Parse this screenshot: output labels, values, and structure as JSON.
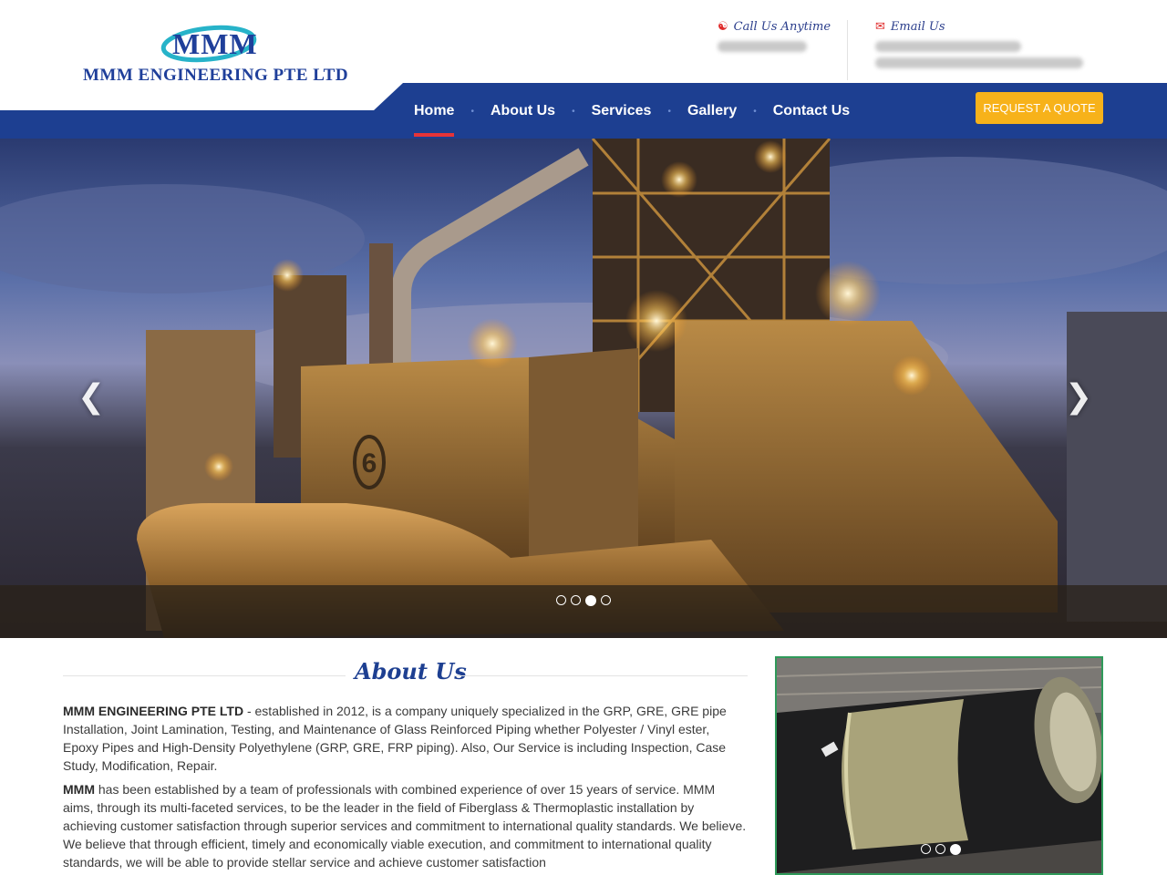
{
  "brand": {
    "logo_mark": "MMM",
    "company_name": "MMM ENGINEERING PTE LTD"
  },
  "contact": {
    "call_title": "Call Us Anytime",
    "call_icon": "headset-icon",
    "email_title": "Email Us",
    "email_icon": "envelope-icon"
  },
  "nav": {
    "items": [
      {
        "label": "Home",
        "active": true
      },
      {
        "label": "About Us",
        "active": false
      },
      {
        "label": "Services",
        "active": false
      },
      {
        "label": "Gallery",
        "active": false
      },
      {
        "label": "Contact Us",
        "active": false
      }
    ],
    "separator": "•",
    "quote_button": "REQUEST A QUOTE"
  },
  "hero": {
    "prev_icon": "chevron-left-icon",
    "next_icon": "chevron-right-icon",
    "slide_count": 4,
    "active_slide": 3,
    "scene_label": "6"
  },
  "about": {
    "title": "About Us",
    "p1_lead": "MMM ENGINEERING PTE LTD",
    "p1_text": " - established in 2012, is a company uniquely specialized in the GRP, GRE, GRE pipe Installation, Joint Lamination, Testing, and Maintenance of Glass Reinforced Piping whether Polyester / Vinyl ester, Epoxy Pipes and High-Density Polyethylene (GRP, GRE, FRP piping). Also, Our Service is including Inspection, Case Study, Modification, Repair.",
    "p2_lead": "MMM",
    "p2_text": " has been established by a team of professionals with combined experience of over 15 years of service. MMM aims, through its multi-faceted services, to be the leader in the field of Fiberglass & Thermoplastic installation by achieving customer satisfaction through superior services and commitment to international quality standards. We believe. We believe that through efficient, timely and economically viable execution, and commitment to international quality standards, we will be able to provide stellar service and achieve customer satisfaction"
  },
  "side_slider": {
    "slide_count": 3,
    "active_slide": 3
  },
  "colors": {
    "brand_blue": "#1d3f91",
    "accent_red": "#e53338",
    "quote_yellow": "#f7b21a",
    "frame_green": "#2f9a5a"
  }
}
